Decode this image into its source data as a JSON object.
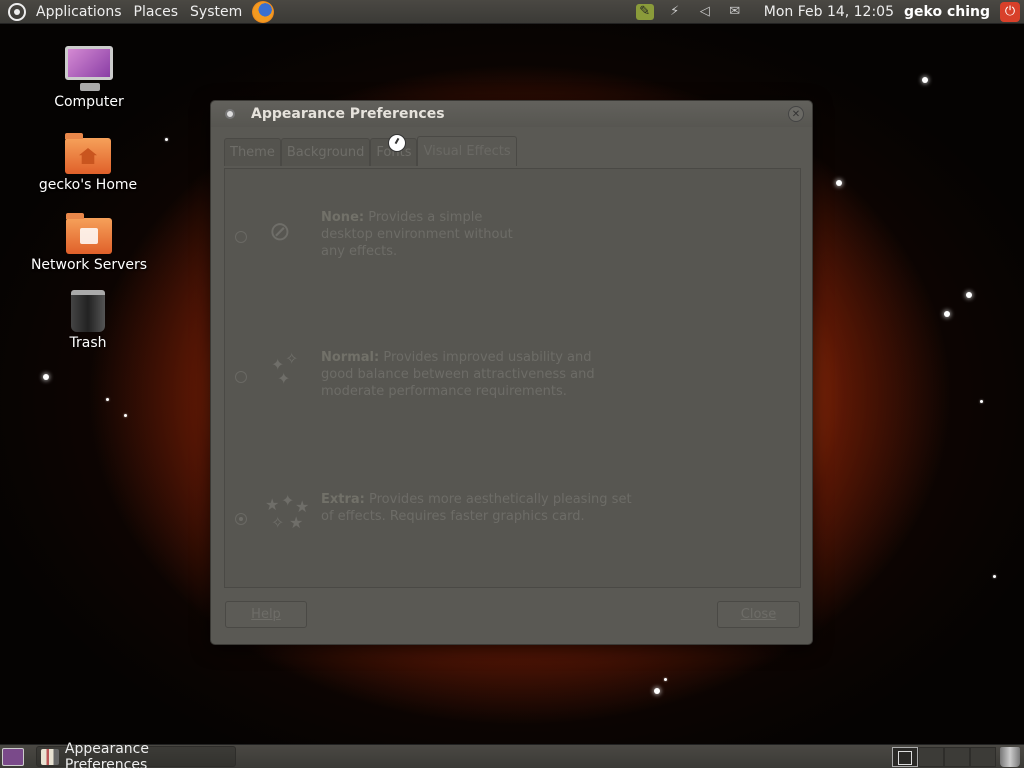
{
  "top_panel": {
    "menus": [
      "Applications",
      "Places",
      "System"
    ],
    "clock": "Mon Feb 14, 12:05",
    "username": "geko ching",
    "tray_icons": [
      "update-notifier-icon",
      "network-icon",
      "volume-icon",
      "mail-icon"
    ]
  },
  "desktop": {
    "icons": [
      {
        "label": "Computer",
        "icon": "computer-icon"
      },
      {
        "label": "gecko's Home",
        "icon": "home-folder-icon"
      },
      {
        "label": "Network Servers",
        "icon": "network-folder-icon"
      },
      {
        "label": "Trash",
        "icon": "trash-icon"
      }
    ]
  },
  "dialog": {
    "title": "Appearance Preferences",
    "tabs": [
      "Theme",
      "Background",
      "Fonts",
      "Visual Effects"
    ],
    "active_tab": "Visual Effects",
    "options": [
      {
        "name": "None:",
        "description": "Provides a simple desktop environment without any effects.",
        "line1": " Provides a simple",
        "line2": "desktop environment without",
        "line3": "any effects.",
        "selected": false
      },
      {
        "name": "Normal:",
        "description": "Provides improved usability and good balance between attractiveness and moderate performance requirements.",
        "line1": " Provides improved usability and",
        "line2": "good balance between attractiveness and",
        "line3": "moderate performance requirements.",
        "selected": false
      },
      {
        "name": "Extra:",
        "description": "Provides more aesthetically pleasing set of effects. Requires faster graphics card.",
        "line1": " Provides more aesthetically pleasing set",
        "line2": "of effects. Requires faster graphics card.",
        "line3": "",
        "selected": true
      }
    ],
    "help_label": "Help",
    "close_label": "Close"
  },
  "bottom_panel": {
    "task_label": "Appearance Preferences",
    "workspaces": 4,
    "active_workspace": 1
  },
  "colors": {
    "panel": "#3b3a36",
    "dialog_bg": "#5a5954",
    "power_button": "#d8402a",
    "nebula_orange": "#cd460e"
  }
}
